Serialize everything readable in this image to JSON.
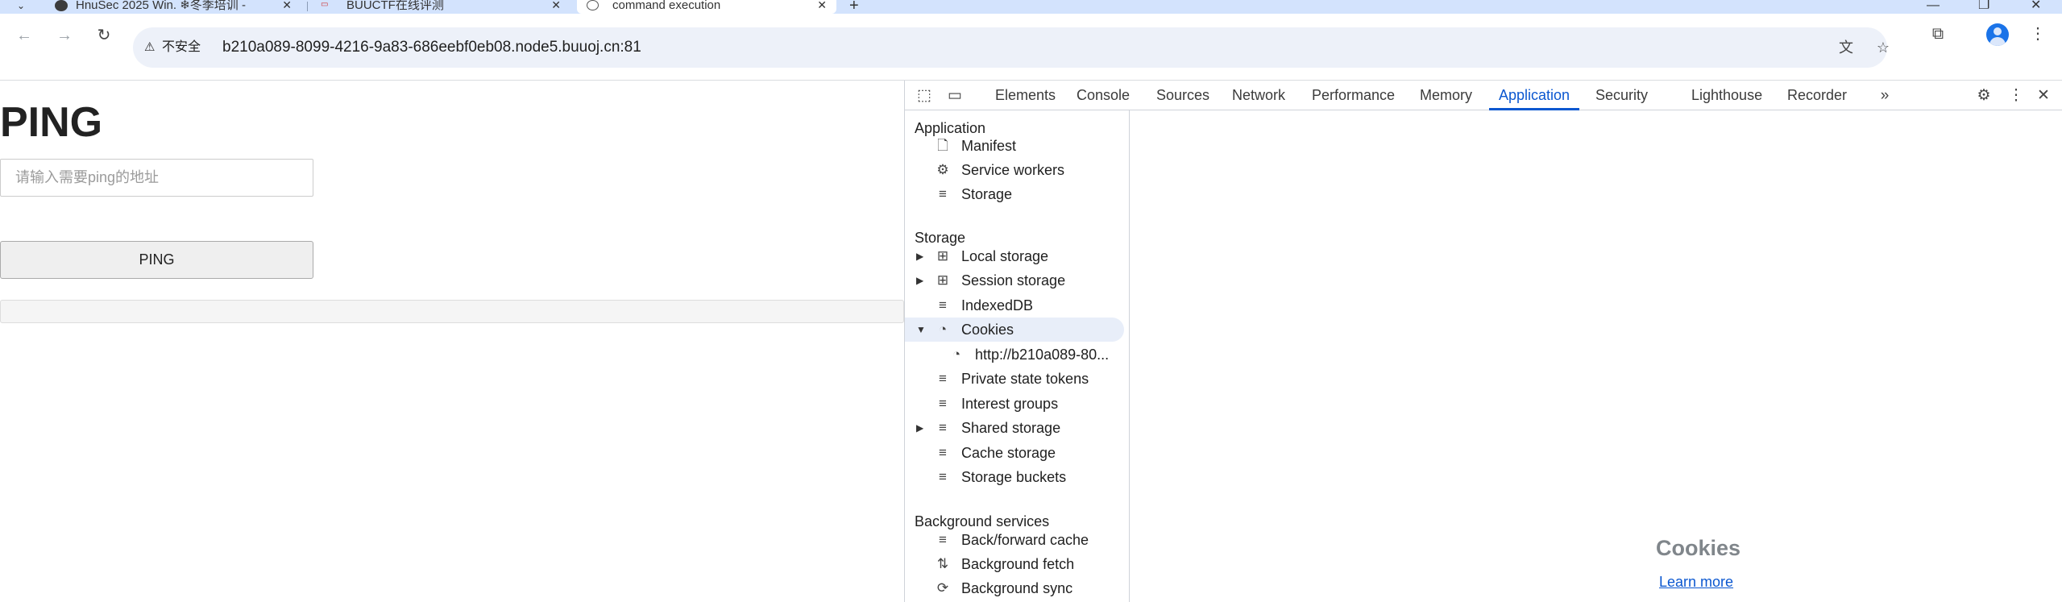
{
  "browser": {
    "tabs": [
      {
        "title": "HnuSec 2025 Win. ❄冬季培训 -",
        "active": false
      },
      {
        "title": "BUUCTF在线评测",
        "active": false
      },
      {
        "title": "command execution",
        "active": true
      }
    ],
    "security_label": "不安全",
    "url": "b210a089-8099-4216-9a83-686eebf0eb08.node5.buuoj.cn:81"
  },
  "page": {
    "title": "PING",
    "input_placeholder": "请输入需要ping的地址",
    "button_label": "PING"
  },
  "devtools": {
    "tabs": [
      "Elements",
      "Console",
      "Sources",
      "Network",
      "Performance",
      "Memory",
      "Application",
      "Security",
      "Lighthouse",
      "Recorder"
    ],
    "active_tab": "Application",
    "sidebar": {
      "application_header": "Application",
      "application_items": [
        "Manifest",
        "Service workers",
        "Storage"
      ],
      "storage_header": "Storage",
      "storage_items": [
        "Local storage",
        "Session storage",
        "IndexedDB",
        "Cookies",
        "http://b210a089-80...",
        "Private state tokens",
        "Interest groups",
        "Shared storage",
        "Cache storage",
        "Storage buckets"
      ],
      "background_header": "Background services",
      "background_items": [
        "Back/forward cache",
        "Background fetch",
        "Background sync"
      ]
    },
    "main": {
      "heading": "Cookies",
      "link": "Learn more"
    }
  },
  "colors": {
    "tabstrip": "#d3e3fd",
    "accent": "#0b57d0",
    "selected_row": "#e8eef9"
  }
}
